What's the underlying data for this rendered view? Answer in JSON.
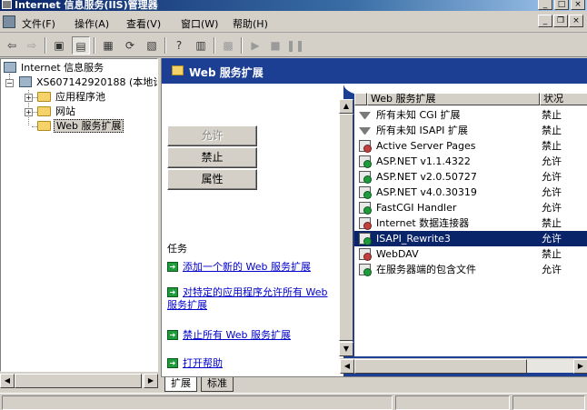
{
  "window": {
    "title": "Internet 信息服务(IIS)管理器",
    "minimize": "_",
    "maximize": "□",
    "close": "×"
  },
  "menubar": {
    "items": [
      "文件(F)",
      "操作(A)",
      "查看(V)",
      "窗口(W)",
      "帮助(H)"
    ],
    "mdi_min": "_",
    "mdi_restore": "❐",
    "mdi_close": "×"
  },
  "toolbar": {
    "back": "⇦",
    "forward": "⇨",
    "up": "▣",
    "show_hide": "▤",
    "properties": "▦",
    "refresh": "⟳",
    "export": "▧",
    "help": "?",
    "console": "▥",
    "computer": "▩",
    "play": "▶",
    "stop": "■",
    "pause": "❚❚"
  },
  "tree": {
    "root": "Internet 信息服务",
    "server": "XS607142920188 (本地计",
    "children": [
      "应用程序池",
      "网站",
      "Web 服务扩展"
    ],
    "expand_sign": "+",
    "collapse_sign": "−"
  },
  "right": {
    "header": "Web 服务扩展",
    "buttons": {
      "allow": "允许",
      "deny": "禁止",
      "properties": "属性"
    },
    "tasks_title": "任务",
    "tasks": [
      "添加一个新的 Web 服务扩展",
      "对特定的应用程序允许所有 Web 服务扩展",
      "禁止所有 Web 服务扩展",
      "打开帮助"
    ],
    "task_arrow": "➔"
  },
  "listview": {
    "columns": [
      "Web 服务扩展",
      "状况"
    ],
    "rows": [
      {
        "name": "所有未知 CGI 扩展",
        "status": "禁止",
        "icon": "filter-icon"
      },
      {
        "name": "所有未知 ISAPI 扩展",
        "status": "禁止",
        "icon": "filter-icon"
      },
      {
        "name": "Active Server Pages",
        "status": "禁止",
        "icon": "extension-icon"
      },
      {
        "name": "ASP.NET v1.1.4322",
        "status": "允许",
        "icon": "extension-icon"
      },
      {
        "name": "ASP.NET v2.0.50727",
        "status": "允许",
        "icon": "extension-icon"
      },
      {
        "name": "ASP.NET v4.0.30319",
        "status": "允许",
        "icon": "extension-icon"
      },
      {
        "name": "FastCGI Handler",
        "status": "允许",
        "icon": "extension-icon"
      },
      {
        "name": "Internet 数据连接器",
        "status": "禁止",
        "icon": "extension-icon"
      },
      {
        "name": "ISAPI_Rewrite3",
        "status": "允许",
        "icon": "extension-icon",
        "selected": true
      },
      {
        "name": "WebDAV",
        "status": "禁止",
        "icon": "extension-icon"
      },
      {
        "name": "在服务器端的包含文件",
        "status": "允许",
        "icon": "extension-icon"
      }
    ]
  },
  "tabs": [
    "扩展",
    "标准"
  ],
  "scroll": {
    "left": "◀",
    "right": "▶",
    "up": "▲",
    "down": "▼"
  },
  "colors": {
    "header_blue": "#1c3f94",
    "selection": "#0a246a",
    "link": "#0000cc"
  }
}
